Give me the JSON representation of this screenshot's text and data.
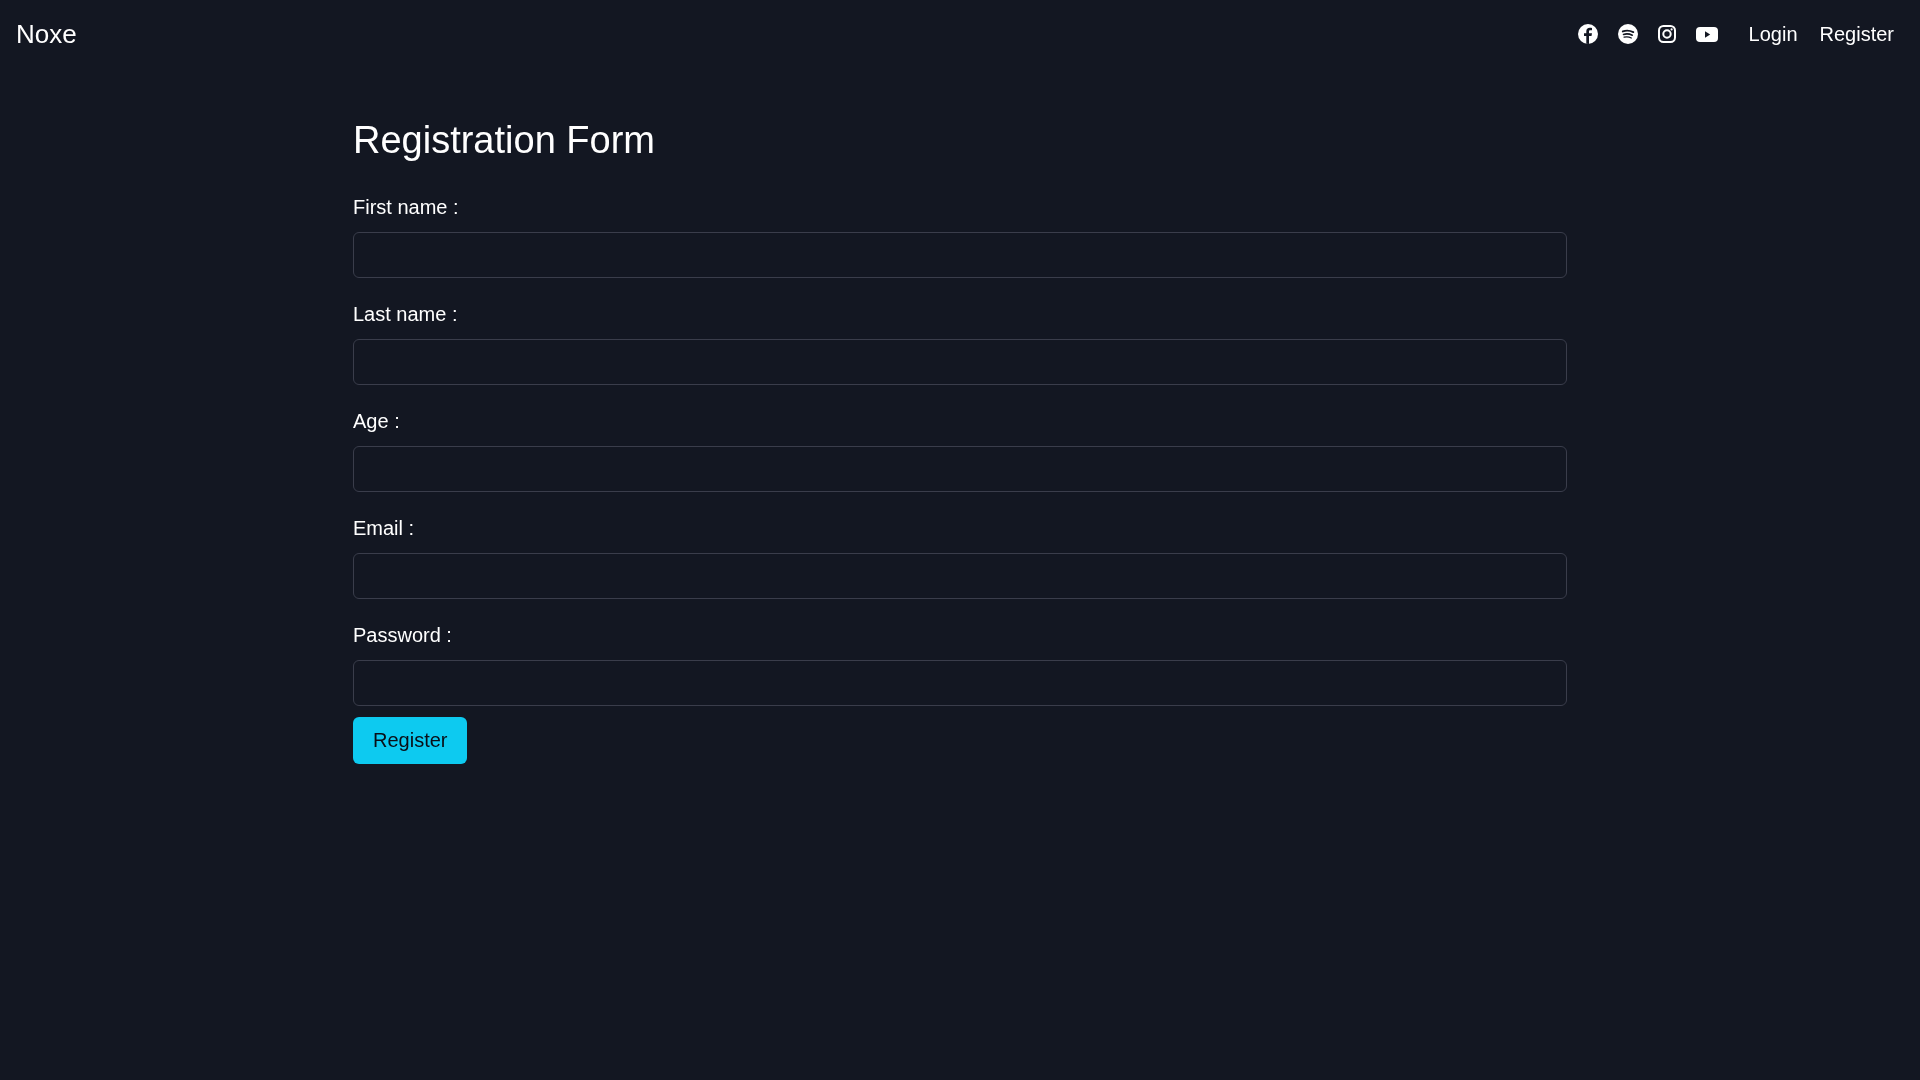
{
  "navbar": {
    "brand": "Noxe",
    "links": [
      "Login",
      "Register"
    ]
  },
  "form": {
    "title": "Registration Form",
    "fields": [
      {
        "label": "First name :"
      },
      {
        "label": "Last name :"
      },
      {
        "label": "Age :"
      },
      {
        "label": "Email :"
      },
      {
        "label": "Password :"
      }
    ],
    "submit": "Register"
  }
}
